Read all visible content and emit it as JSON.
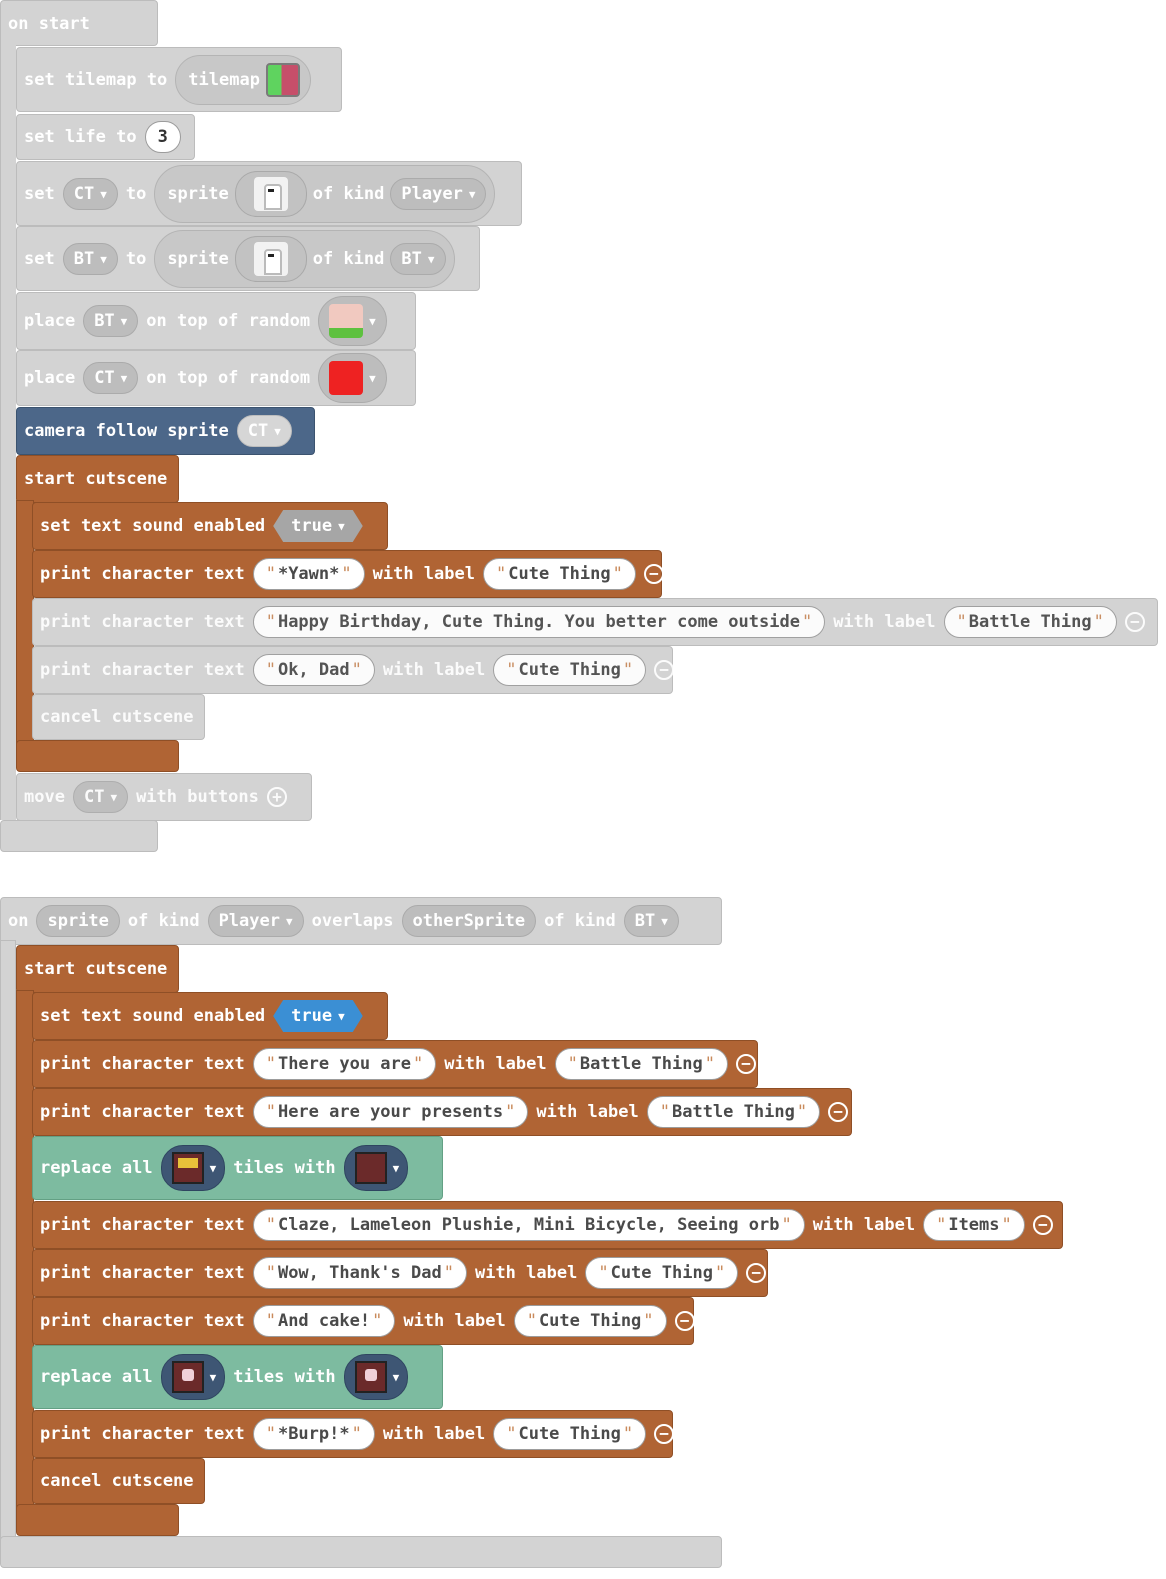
{
  "colors": {
    "event_gray": "#d3d3d3",
    "cutscene_brown": "#b06434",
    "camera_blue": "#4c6789",
    "tiles_green": "#7dbba0",
    "bool_blue": "#3b8fd4"
  },
  "on_start": {
    "header": "on start",
    "set_tilemap": {
      "label": "set tilemap to",
      "value": "tilemap"
    },
    "set_life": {
      "label": "set life to",
      "value": "3"
    },
    "set_ct": {
      "set": "set",
      "var": "CT",
      "to": "to",
      "sprite": "sprite",
      "of_kind": "of kind",
      "kind": "Player"
    },
    "set_bt": {
      "set": "set",
      "var": "BT",
      "to": "to",
      "sprite": "sprite",
      "of_kind": "of kind",
      "kind": "BT"
    },
    "place_bt": {
      "place": "place",
      "var": "BT",
      "rest": "on top of random"
    },
    "place_ct": {
      "place": "place",
      "var": "CT",
      "rest": "on top of random"
    },
    "camera": {
      "label": "camera follow sprite",
      "var": "CT"
    },
    "cutscene": {
      "start": "start cutscene",
      "sound": {
        "label": "set text sound enabled",
        "value": "true"
      },
      "prints": [
        {
          "label": "print character text",
          "text": "*Yawn*",
          "with": "with label",
          "who": "Cute Thing"
        },
        {
          "label": "print character text",
          "text": "Happy Birthday, Cute Thing. You better come outside",
          "with": "with label",
          "who": "Battle Thing"
        },
        {
          "label": "print character text",
          "text": "Ok, Dad",
          "with": "with label",
          "who": "Cute Thing"
        }
      ],
      "cancel": "cancel cutscene"
    },
    "move": {
      "move": "move",
      "var": "CT",
      "rest": "with buttons"
    }
  },
  "on_overlap": {
    "on": "on",
    "sprite": "sprite",
    "of_kind": "of kind",
    "kind1": "Player",
    "overlaps": "overlaps",
    "other": "otherSprite",
    "of_kind2": "of kind",
    "kind2": "BT",
    "cutscene": {
      "start": "start cutscene",
      "sound": {
        "label": "set text sound enabled",
        "value": "true"
      },
      "p1": {
        "label": "print character text",
        "text": "There you are",
        "with": "with label",
        "who": "Battle Thing"
      },
      "p2": {
        "label": "print character text",
        "text": "Here are your presents",
        "with": "with label",
        "who": "Battle Thing"
      },
      "r1": {
        "label": "replace all",
        "mid": "tiles with"
      },
      "p3": {
        "label": "print character text",
        "text": "Claze, Lameleon Plushie, Mini Bicycle, Seeing orb",
        "with": "with label",
        "who": "Items"
      },
      "p4": {
        "label": "print character text",
        "text": "Wow, Thank's Dad",
        "with": "with label",
        "who": "Cute Thing"
      },
      "p5": {
        "label": "print character text",
        "text": "And cake!",
        "with": "with label",
        "who": "Cute Thing"
      },
      "r2": {
        "label": "replace all",
        "mid": "tiles with"
      },
      "p6": {
        "label": "print character text",
        "text": "*Burp!*",
        "with": "with label",
        "who": "Cute Thing"
      },
      "cancel": "cancel cutscene"
    }
  }
}
